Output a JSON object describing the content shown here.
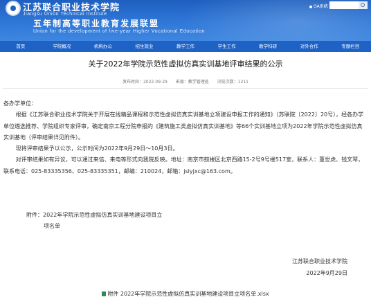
{
  "header": {
    "school_cn": "江苏联合职业技术学院",
    "school_en": "Jiangsu Union Technical Institute",
    "slogan_cn": "五年制高等职业教育发展联盟",
    "slogan_en": "Union for the development of five-year Higher Vocational Education",
    "oa_label": "OA系统"
  },
  "nav": [
    "首页",
    "学院概况",
    "机构办公",
    "招生就业",
    "教学工作",
    "学生工作",
    "教学科研",
    "对外合作",
    "专题栏目"
  ],
  "article": {
    "title": "关于2022年学院示范性虚拟仿真实训基地评审结果的公示",
    "publish_label": "发布时间：2022-09-29",
    "source_label": "来源：教学管理处",
    "views_label": "浏览次数：1211",
    "greeting": "各办学单位：",
    "para1": "根据《江苏联合职业技术学院关于开展在线精品课程和示范性虚拟仿真实训基地立项建设申报工作的通知》（苏联院〔2022〕20号），经各办学单位遴选推荐、学院组织专家评审，确定南京工程分院申报的《建筑施工类虚拟仿真实训基地》等66个实训基地立项为2022年学院示范性虚拟仿真实训基地（评审结果详见附件）。",
    "para2": "现将评审结果予以公示，公示时间为2022年9月29日～10月3日。",
    "para3": "对评审结果如有异议，可以通过来信、来电等形式向我院反映。地址：南京市鼓楼区北京西路15-2号9号楼517室，联系人：董世虎、钱文琴，联系电话：025-83335356、025-83335351，邮编：210024，邮箱：jslyjxc@163.com。",
    "attachment_line1": "附件：2022年学院示范性虚拟仿真实训基地建设项目立",
    "attachment_line2": "项名单",
    "signature_org": "江苏联合职业技术学院",
    "signature_date": "2022年9月29日",
    "file_link": "附件 2022年学院示范性虚拟仿真实训基地建设项目立项名单.xlsx"
  }
}
